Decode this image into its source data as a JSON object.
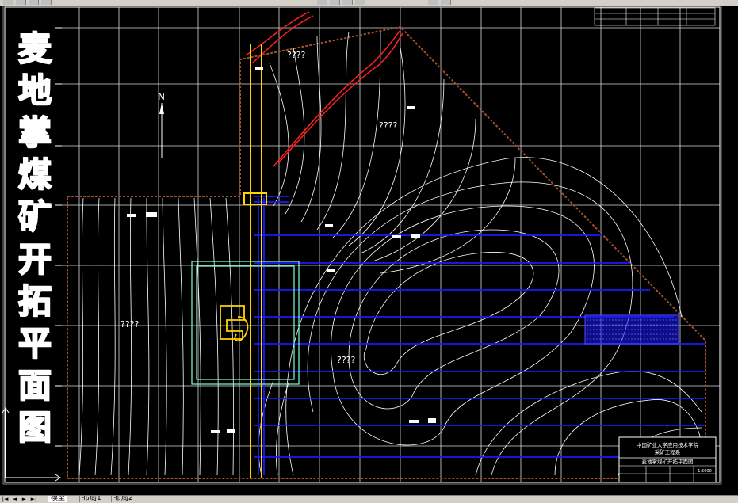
{
  "drawing_title_chars": [
    "麦",
    "地",
    "掌",
    "煤",
    "矿",
    "开",
    "拓",
    "平",
    "面",
    "图"
  ],
  "unknown_labels": [
    "????",
    "????",
    "????",
    "????"
  ],
  "north_letter": "N",
  "title_block": {
    "university": "中国矿业大学应用技术学院",
    "department": "采矿工程系",
    "drawing_name": "麦地掌煤矿开拓平面图",
    "scale": "1:5000"
  },
  "layout_tabs": [
    "模型",
    "布局1",
    "布局2"
  ],
  "active_tab": 0,
  "colors": {
    "background": "#000000",
    "contour": "#ffffff",
    "grid": "#ffffff",
    "boundary": "#a0522d",
    "roadway_blue": "#1a1aff",
    "shaft_yellow": "#ffd400",
    "industrial_cyan": "#7fffd4",
    "fault_red": "#ff2020"
  }
}
